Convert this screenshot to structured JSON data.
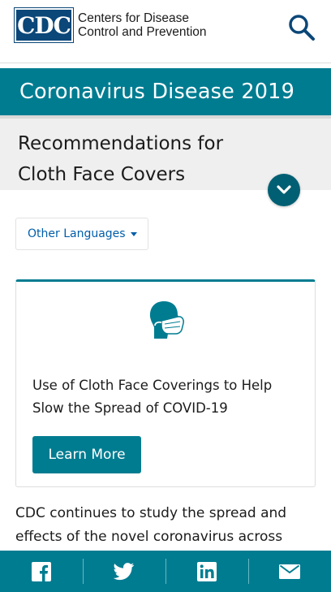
{
  "header": {
    "logo_mark": "CDC",
    "org_line1": "Centers for Disease",
    "org_line2": "Control and Prevention",
    "search_icon": "search-icon"
  },
  "banner": {
    "title": "Coronavirus Disease 2019"
  },
  "page": {
    "title_line1": "Recommendations for",
    "title_line2": "Cloth Face Covers"
  },
  "language": {
    "label": "Other Languages"
  },
  "card": {
    "icon": "face-mask-icon",
    "text": "Use of Cloth Face Coverings to Help Slow the Spread of COVID-19",
    "button_label": "Learn More"
  },
  "body": {
    "text": "CDC continues to study the spread and effects of the novel coronavirus across"
  },
  "share": {
    "icons": [
      "facebook-icon",
      "twitter-icon",
      "linkedin-icon",
      "email-icon"
    ]
  },
  "colors": {
    "teal": "#007c91",
    "dark_teal": "#005f73",
    "cdc_blue": "#0b4778",
    "link_blue": "#005eaa"
  }
}
